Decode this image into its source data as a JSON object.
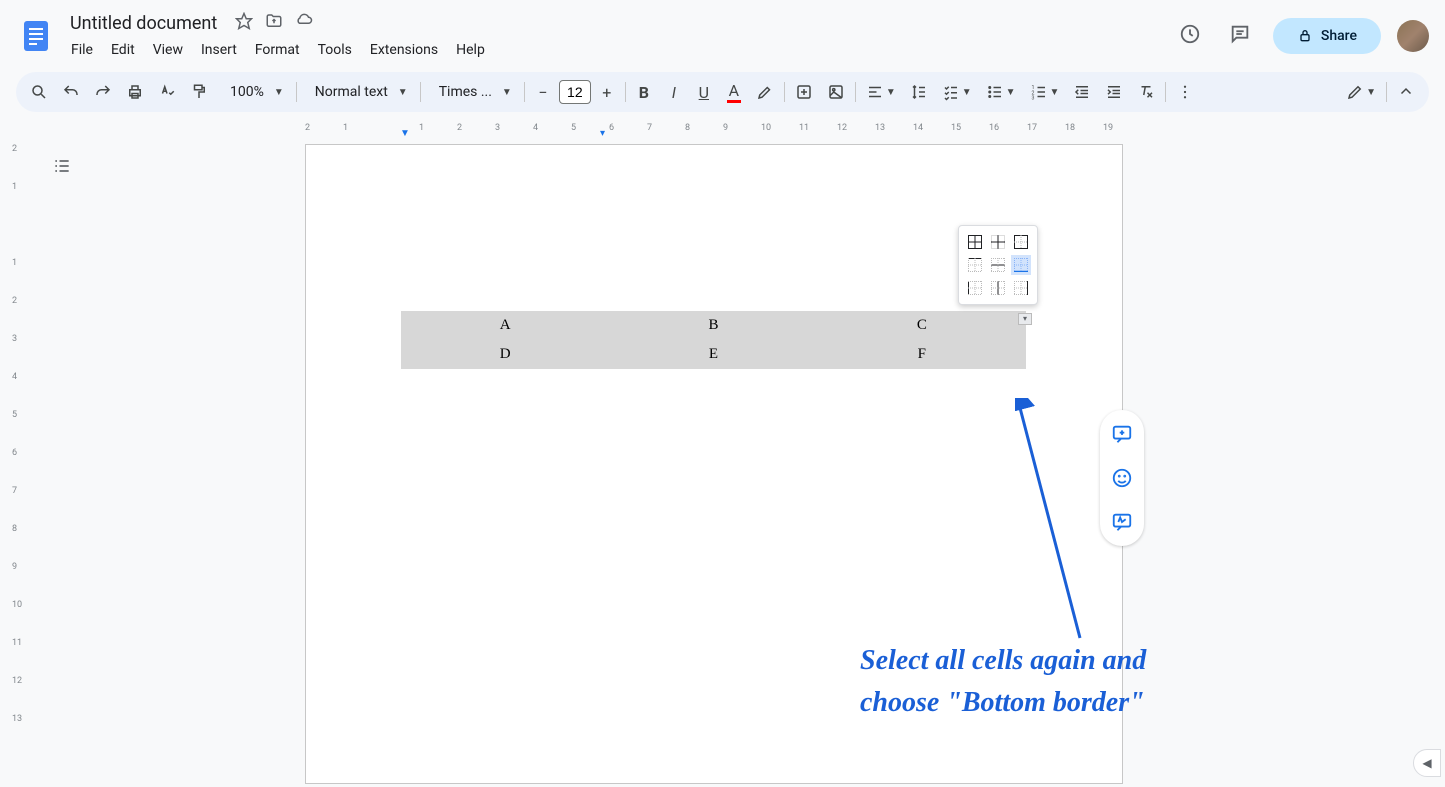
{
  "header": {
    "doc_title": "Untitled document",
    "menu": [
      "File",
      "Edit",
      "View",
      "Insert",
      "Format",
      "Tools",
      "Extensions",
      "Help"
    ],
    "share_label": "Share"
  },
  "toolbar": {
    "zoom": "100%",
    "style": "Normal text",
    "font": "Times ...",
    "font_size": "12"
  },
  "ruler_h": [
    "2",
    "1",
    "",
    "1",
    "2",
    "3",
    "4",
    "5",
    "6",
    "7",
    "8",
    "9",
    "10",
    "11",
    "12",
    "13",
    "14",
    "15",
    "16",
    "17",
    "18",
    "19"
  ],
  "ruler_v": [
    "2",
    "1",
    "",
    "1",
    "2",
    "3",
    "4",
    "5",
    "6",
    "7",
    "8",
    "9",
    "10",
    "11",
    "12",
    "13"
  ],
  "table": {
    "rows": [
      [
        "A",
        "B",
        "C"
      ],
      [
        "D",
        "E",
        "F"
      ]
    ]
  },
  "border_menu": {
    "options": [
      "all",
      "inner",
      "outer",
      "top",
      "horizontal",
      "bottom",
      "left",
      "vertical",
      "right"
    ],
    "selected": "bottom"
  },
  "annotation": {
    "line1": "Select all cells again and",
    "line2": "choose \"Bottom border\""
  }
}
